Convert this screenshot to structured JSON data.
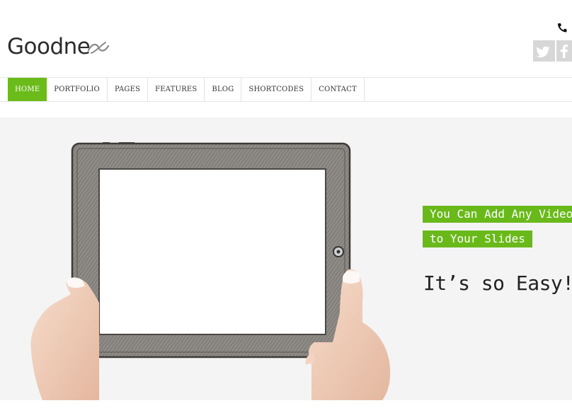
{
  "header": {
    "logo_text": "Goodne",
    "phone_icon": "phone-icon",
    "social": [
      {
        "name": "twitter",
        "icon": "twitter-bird-icon"
      },
      {
        "name": "facebook",
        "icon": "facebook-f-icon"
      }
    ]
  },
  "nav": {
    "items": [
      {
        "label": "HOME",
        "active": true
      },
      {
        "label": "PORTFOLIO"
      },
      {
        "label": "PAGES"
      },
      {
        "label": "FEATURES"
      },
      {
        "label": "BLOG"
      },
      {
        "label": "SHORTCODES"
      },
      {
        "label": "CONTACT"
      }
    ]
  },
  "slider": {
    "caption_line_1": "You Can Add Any Video",
    "caption_line_2": "to Your Slides",
    "tagline": "It’s so Easy!"
  },
  "colors": {
    "accent": "#6bbb1a",
    "hero_background": "#f4f4f4",
    "social_background": "#d7d7d7"
  }
}
